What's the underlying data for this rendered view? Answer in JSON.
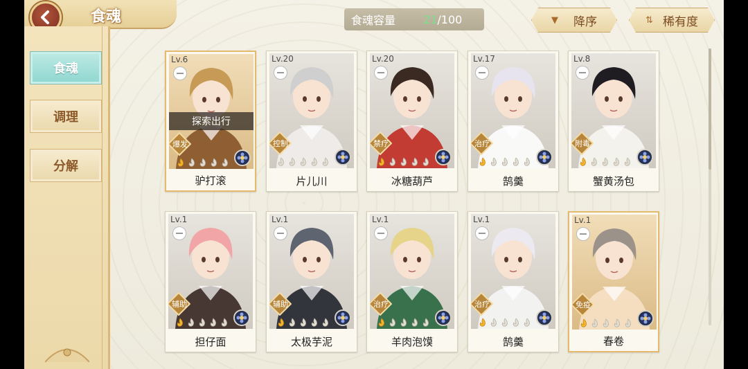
{
  "header": {
    "title": "食魂",
    "capacity_label": "食魂容量",
    "capacity_current": "21",
    "capacity_max": "/100",
    "sort_order": "降序",
    "sort_by": "稀有度"
  },
  "sidebar": {
    "tabs": [
      {
        "label": "食魂",
        "active": true
      },
      {
        "label": "调理",
        "active": false
      },
      {
        "label": "分解",
        "active": false
      }
    ]
  },
  "cards": [
    {
      "level": "Lv.6",
      "role": "爆发",
      "name": "驴打滚",
      "status": "探索出行",
      "stars_lit": 1,
      "rarity": "gold"
    },
    {
      "level": "Lv.20",
      "role": "控制",
      "name": "片儿川",
      "status": "",
      "stars_lit": 0,
      "rarity": "silver"
    },
    {
      "level": "Lv.20",
      "role": "禁疗",
      "name": "冰糖葫芦",
      "status": "",
      "stars_lit": 1,
      "rarity": "silver"
    },
    {
      "level": "Lv.17",
      "role": "治疗",
      "name": "鹄羹",
      "status": "",
      "stars_lit": 1,
      "rarity": "silver"
    },
    {
      "level": "Lv.8",
      "role": "附毒",
      "name": "蟹黄汤包",
      "status": "",
      "stars_lit": 1,
      "rarity": "silver"
    },
    {
      "level": "Lv.1",
      "role": "辅助",
      "name": "担仔面",
      "status": "",
      "stars_lit": 1,
      "rarity": "silver"
    },
    {
      "level": "Lv.1",
      "role": "辅助",
      "name": "太极芋泥",
      "status": "",
      "stars_lit": 1,
      "rarity": "silver"
    },
    {
      "level": "Lv.1",
      "role": "治疗",
      "name": "羊肉泡馍",
      "status": "",
      "stars_lit": 1,
      "rarity": "silver"
    },
    {
      "level": "Lv.1",
      "role": "治疗",
      "name": "鹄羹",
      "status": "",
      "stars_lit": 1,
      "rarity": "silver"
    },
    {
      "level": "Lv.1",
      "role": "免疫",
      "name": "春卷",
      "status": "",
      "stars_lit": 1,
      "rarity": "gold"
    }
  ],
  "colors": {
    "hair": [
      "#c79a55",
      "#cfcfcf",
      "#3b2a22",
      "#e8e4ef",
      "#1f1c22",
      "#f2a5a6",
      "#5e6470",
      "#e6d48a",
      "#eceaf0",
      "#9b928a"
    ],
    "outfit": [
      "#8a5a2e",
      "#f0ecea",
      "#c1342b",
      "#fbfbfb",
      "#f6f3ee",
      "#3f2f2b",
      "#2a2c35",
      "#2f6b46",
      "#f3f3f3",
      "#f6dfc3"
    ]
  }
}
